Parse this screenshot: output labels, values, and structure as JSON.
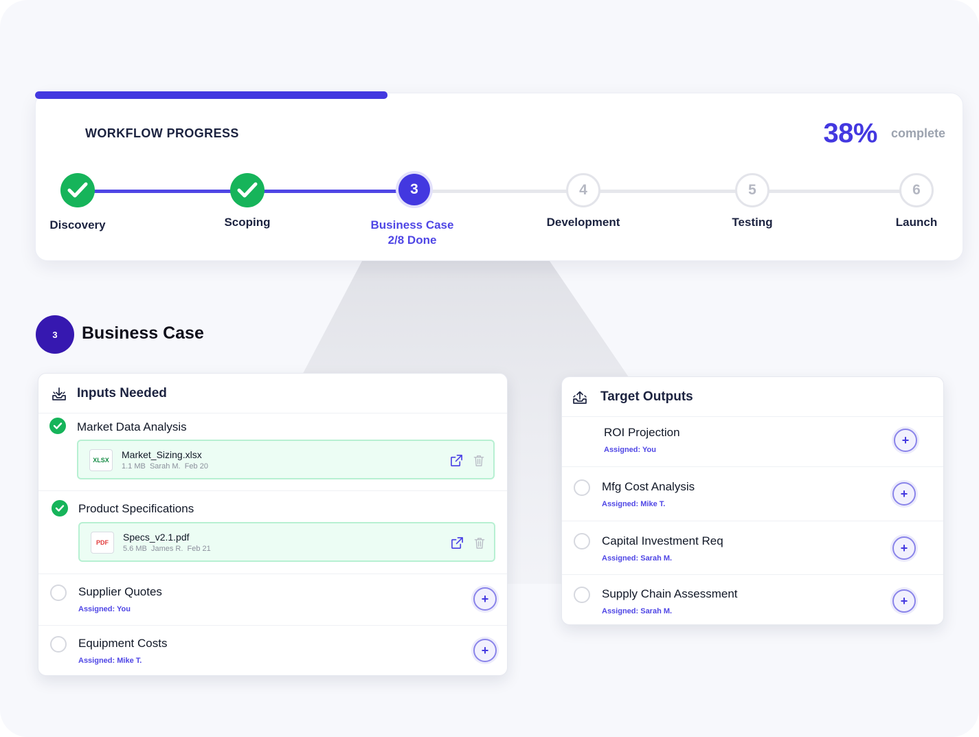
{
  "workflow": {
    "title": "WORKFLOW PROGRESS",
    "progress_fraction": 0.38,
    "percent": "38%",
    "percent_label": "complete",
    "steps": [
      {
        "number": "1",
        "label": "Discovery",
        "status": "done"
      },
      {
        "number": "2",
        "label": "Scoping",
        "status": "done"
      },
      {
        "number": "3",
        "label": "Business Case",
        "sublabel": "2/8 Done",
        "status": "current"
      },
      {
        "number": "4",
        "label": "Development",
        "status": "todo"
      },
      {
        "number": "5",
        "label": "Testing",
        "status": "todo"
      },
      {
        "number": "6",
        "label": "Launch",
        "status": "todo"
      }
    ]
  },
  "section": {
    "number": "3",
    "title": "Business Case"
  },
  "inputs": {
    "title": "Inputs Needed",
    "icon": "inbox-download-icon",
    "items": [
      {
        "title": "Market Data Analysis",
        "status": "done",
        "file": {
          "type": "XLSX",
          "name": "Market_Sizing.xlsx",
          "meta": "1.1 MB  Sarah M.  Feb 20"
        }
      },
      {
        "title": "Product Specifications",
        "status": "done",
        "file": {
          "type": "PDF",
          "name": "Specs_v2.1.pdf",
          "meta": "5.6 MB  James R.  Feb 21"
        }
      },
      {
        "title": "Supplier Quotes",
        "status": "todo",
        "assigned": "Assigned: You"
      },
      {
        "title": "Equipment Costs",
        "status": "todo",
        "assigned": "Assigned: Mike T."
      }
    ]
  },
  "outputs": {
    "title": "Target Outputs",
    "icon": "outbox-upload-icon",
    "items": [
      {
        "title": "ROI Projection",
        "assigned": "Assigned: You",
        "status": "none"
      },
      {
        "title": "Mfg Cost Analysis",
        "assigned": "Assigned: Mike T.",
        "status": "todo"
      },
      {
        "title": "Capital Investment Req",
        "assigned": "Assigned: Sarah M.",
        "status": "todo"
      },
      {
        "title": "Supply Chain Assessment",
        "assigned": "Assigned: Sarah M.",
        "status": "todo"
      }
    ],
    "add_symbol": "+"
  },
  "colors": {
    "accent": "#4338e0",
    "success": "#16b45a",
    "section_badge": "#3618b0",
    "file_bg": "#ecfdf4"
  }
}
